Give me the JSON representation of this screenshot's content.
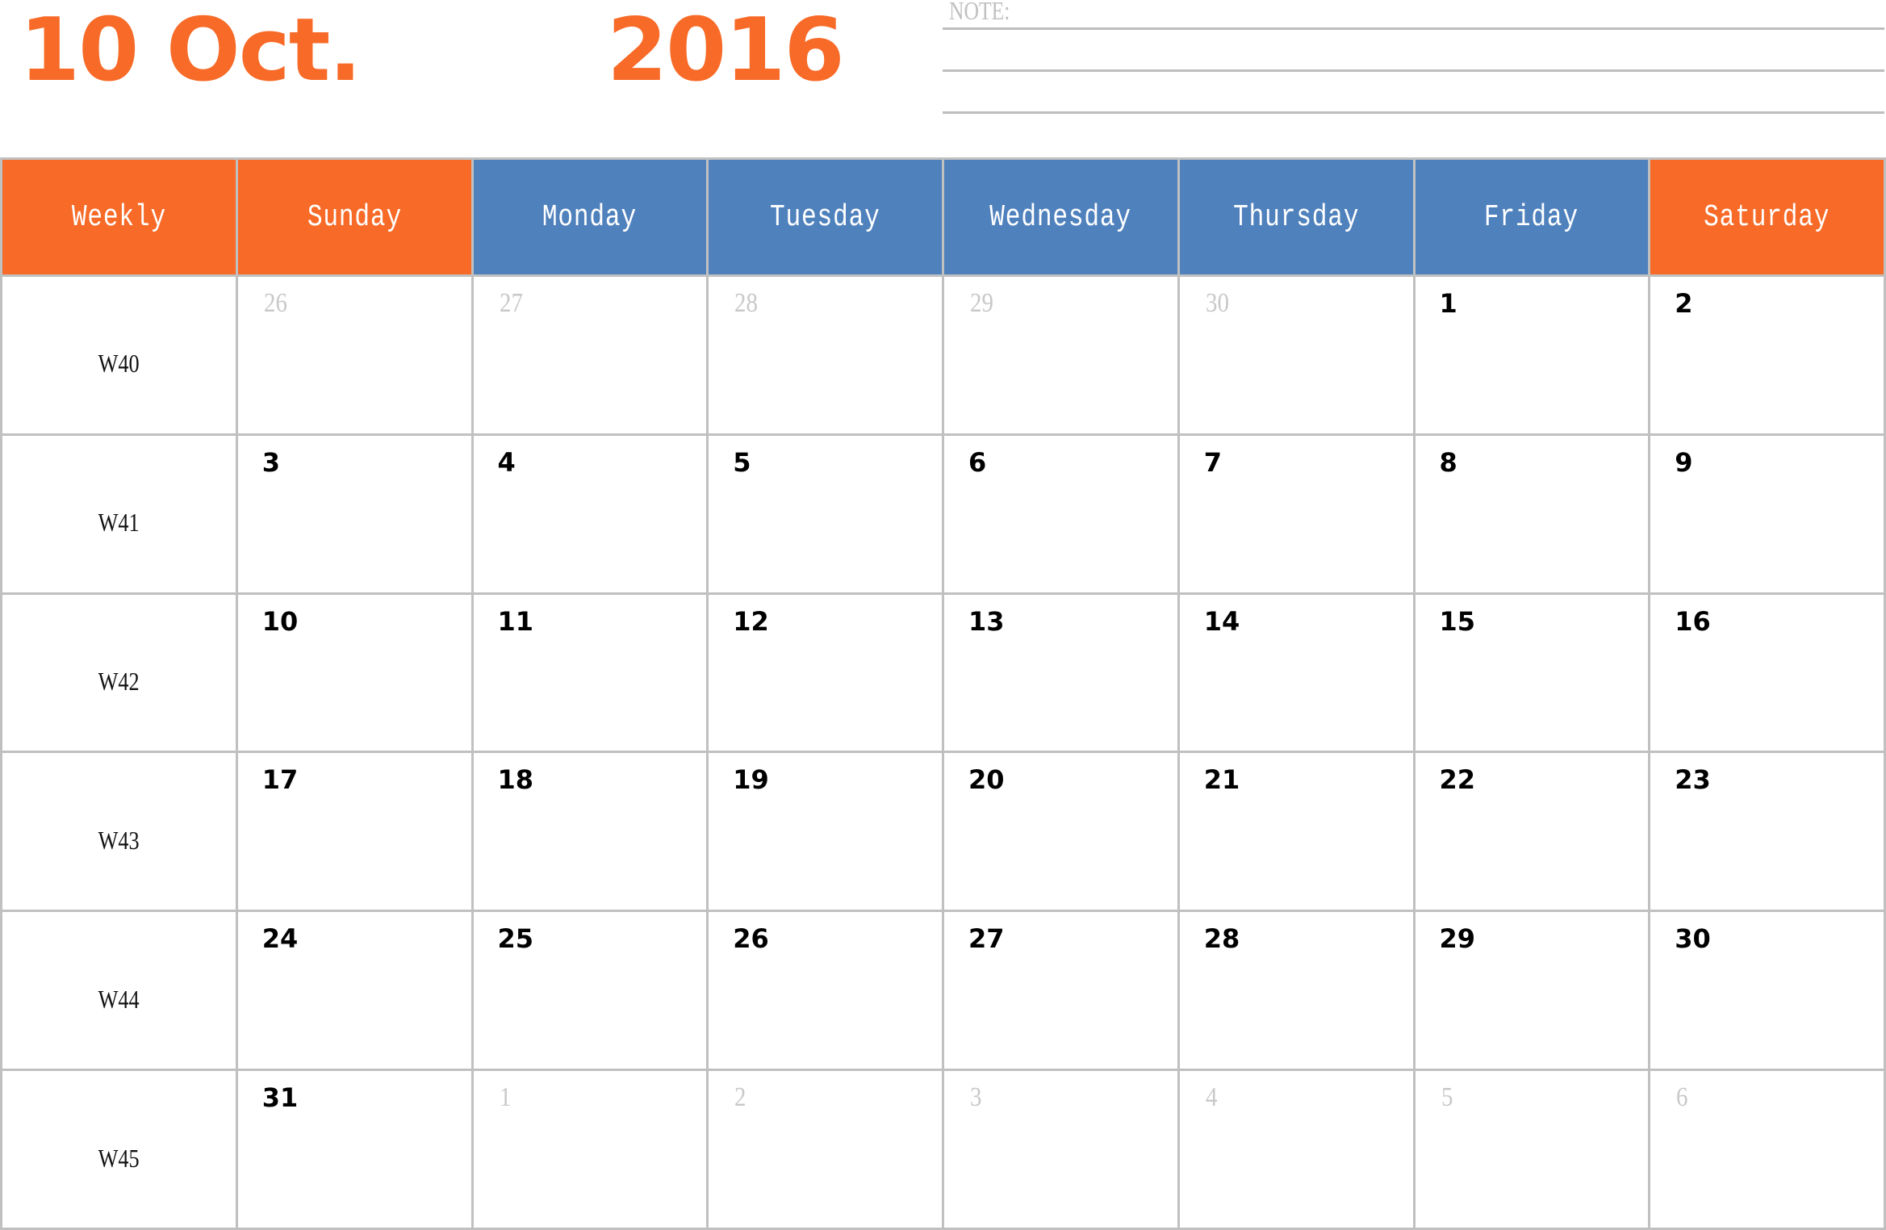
{
  "header": {
    "month_title": "10 Oct.",
    "year_title": "2016",
    "note_label": "NOTE:"
  },
  "colors": {
    "weekend_header": "#F76A27",
    "weekday_header": "#4F81BD",
    "title": "#F76A27",
    "grid_line": "#C0C0C0",
    "out_of_month_date": "#C8C8C8"
  },
  "calendar": {
    "columns": [
      {
        "label": "Weekly",
        "type": "weekend"
      },
      {
        "label": "Sunday",
        "type": "weekend"
      },
      {
        "label": "Monday",
        "type": "weekday"
      },
      {
        "label": "Tuesday",
        "type": "weekday"
      },
      {
        "label": "Wednesday",
        "type": "weekday"
      },
      {
        "label": "Thursday",
        "type": "weekday"
      },
      {
        "label": "Friday",
        "type": "weekday"
      },
      {
        "label": "Saturday",
        "type": "weekend"
      }
    ],
    "weeks": [
      {
        "week": "W40",
        "days": [
          {
            "d": "26",
            "in_month": false
          },
          {
            "d": "27",
            "in_month": false
          },
          {
            "d": "28",
            "in_month": false
          },
          {
            "d": "29",
            "in_month": false
          },
          {
            "d": "30",
            "in_month": false
          },
          {
            "d": "1",
            "in_month": true
          },
          {
            "d": "2",
            "in_month": true
          }
        ]
      },
      {
        "week": "W41",
        "days": [
          {
            "d": "3",
            "in_month": true
          },
          {
            "d": "4",
            "in_month": true
          },
          {
            "d": "5",
            "in_month": true
          },
          {
            "d": "6",
            "in_month": true
          },
          {
            "d": "7",
            "in_month": true
          },
          {
            "d": "8",
            "in_month": true
          },
          {
            "d": "9",
            "in_month": true
          }
        ]
      },
      {
        "week": "W42",
        "days": [
          {
            "d": "10",
            "in_month": true
          },
          {
            "d": "11",
            "in_month": true
          },
          {
            "d": "12",
            "in_month": true
          },
          {
            "d": "13",
            "in_month": true
          },
          {
            "d": "14",
            "in_month": true
          },
          {
            "d": "15",
            "in_month": true
          },
          {
            "d": "16",
            "in_month": true
          }
        ]
      },
      {
        "week": "W43",
        "days": [
          {
            "d": "17",
            "in_month": true
          },
          {
            "d": "18",
            "in_month": true
          },
          {
            "d": "19",
            "in_month": true
          },
          {
            "d": "20",
            "in_month": true
          },
          {
            "d": "21",
            "in_month": true
          },
          {
            "d": "22",
            "in_month": true
          },
          {
            "d": "23",
            "in_month": true
          }
        ]
      },
      {
        "week": "W44",
        "days": [
          {
            "d": "24",
            "in_month": true
          },
          {
            "d": "25",
            "in_month": true
          },
          {
            "d": "26",
            "in_month": true
          },
          {
            "d": "27",
            "in_month": true
          },
          {
            "d": "28",
            "in_month": true
          },
          {
            "d": "29",
            "in_month": true
          },
          {
            "d": "30",
            "in_month": true
          }
        ]
      },
      {
        "week": "W45",
        "days": [
          {
            "d": "31",
            "in_month": true
          },
          {
            "d": "1",
            "in_month": false
          },
          {
            "d": "2",
            "in_month": false
          },
          {
            "d": "3",
            "in_month": false
          },
          {
            "d": "4",
            "in_month": false
          },
          {
            "d": "5",
            "in_month": false
          },
          {
            "d": "6",
            "in_month": false
          }
        ]
      }
    ]
  }
}
